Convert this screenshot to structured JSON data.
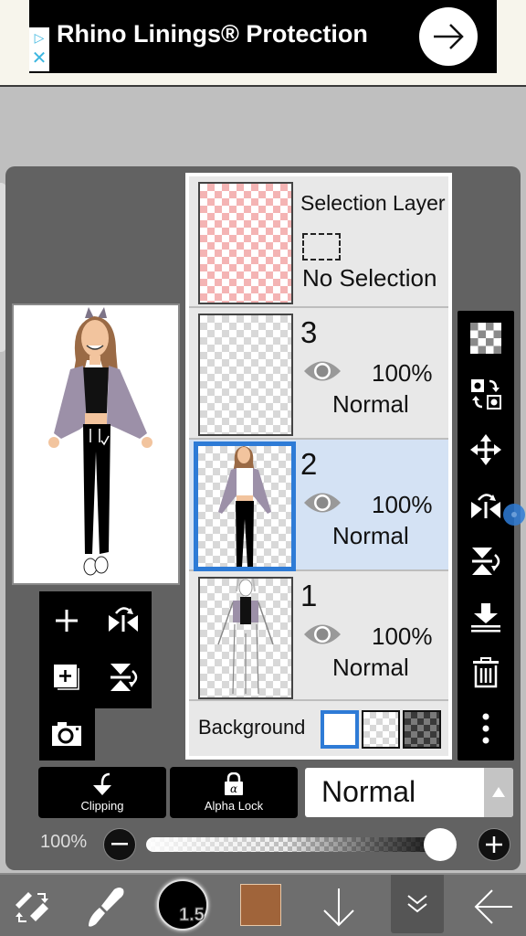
{
  "ad": {
    "title": "Rhino Linings® Protection",
    "adchoices_icon": "adchoices-icon",
    "close_icon": "close-icon",
    "cta_icon": "arrow-right-icon"
  },
  "layers": {
    "selection_layer": {
      "title": "Selection Layer",
      "status": "No Selection"
    },
    "items": [
      {
        "number": "3",
        "opacity": "100%",
        "blend": "Normal",
        "visible": true,
        "selected": false
      },
      {
        "number": "2",
        "opacity": "100%",
        "blend": "Normal",
        "visible": true,
        "selected": true
      },
      {
        "number": "1",
        "opacity": "100%",
        "blend": "Normal",
        "visible": true,
        "selected": false
      }
    ],
    "background": {
      "label": "Background",
      "options": [
        "white",
        "transparent",
        "dark-checker"
      ],
      "selected": "white"
    }
  },
  "left_tools": [
    "add-layer",
    "flip-horizontal",
    "duplicate-layer",
    "flip-vertical",
    "camera"
  ],
  "right_tools": [
    "transparency",
    "swap-layer",
    "move",
    "flip-horizontal",
    "flip-vertical",
    "merge-down",
    "delete",
    "more"
  ],
  "controls": {
    "clipping_label": "Clipping",
    "alpha_lock_label": "Alpha Lock",
    "blend_mode": "Normal",
    "opacity_label": "100%",
    "opacity_value": 1.0
  },
  "bottom_bar": {
    "brush_size": "1.5",
    "current_color": "#a0643a",
    "tools": [
      "transform-swap",
      "brush",
      "brush-size",
      "color",
      "move-down",
      "collapse",
      "back"
    ]
  },
  "colors": {
    "selection_blue": "#2e7bd6",
    "selected_layer_bg": "#d4e2f4",
    "panel_bg": "#626262",
    "toolbar_bg": "#000000"
  }
}
